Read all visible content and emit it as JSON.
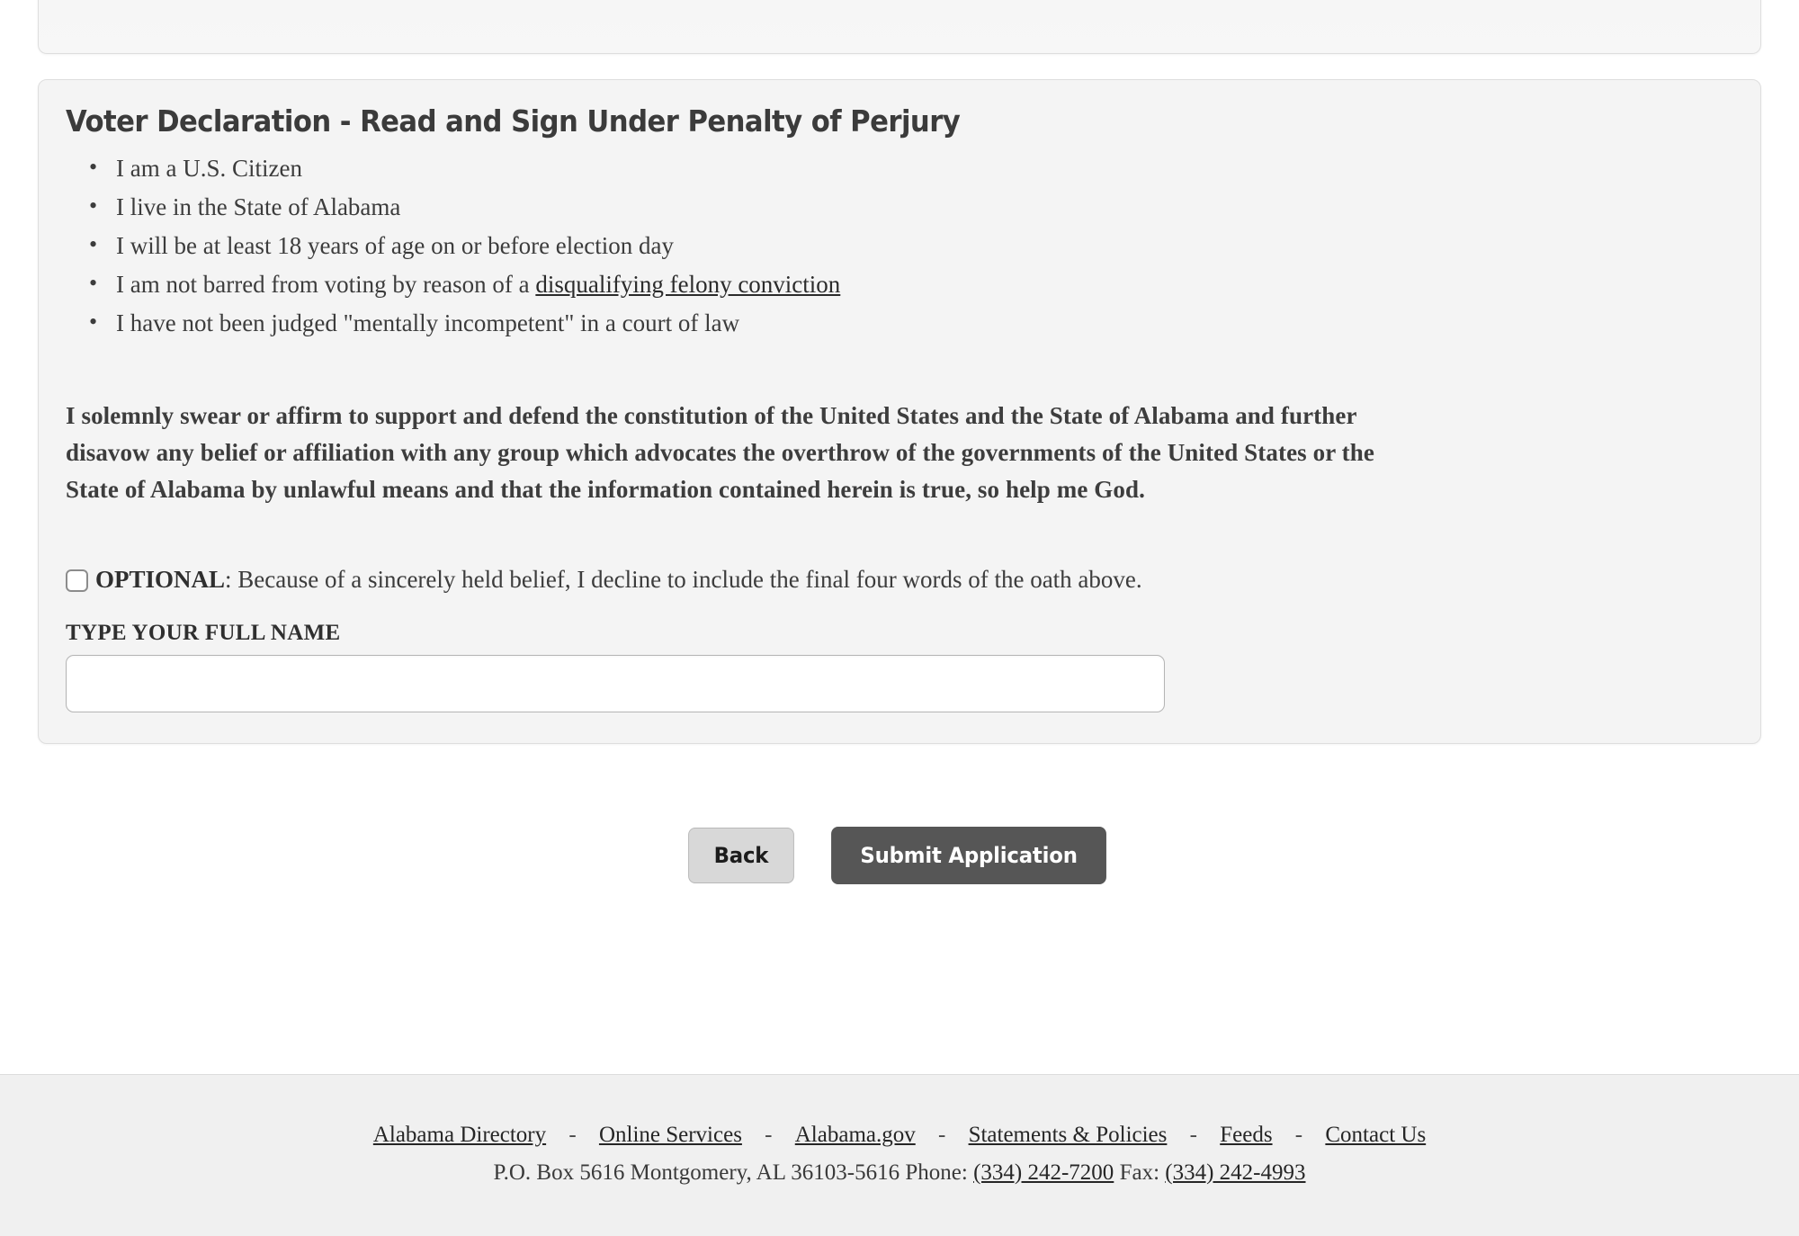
{
  "declaration": {
    "title": "Voter Declaration - Read and Sign Under Penalty of Perjury",
    "bullets": [
      {
        "text": "I am a U.S. Citizen"
      },
      {
        "text": "I live in the State of Alabama"
      },
      {
        "text": "I will be at least 18 years of age on or before election day"
      },
      {
        "text_before": "I am not barred from voting by reason of a ",
        "link": "disqualifying felony conviction"
      },
      {
        "text": "I have not been judged \"mentally incompetent\" in a court of law"
      }
    ],
    "oath": "I solemnly swear or affirm to support and defend the constitution of the United States and the State of Alabama and further disavow any belief or affiliation with any group which advocates the overthrow of the governments of the United States or the State of Alabama by unlawful means and that the information contained herein is true, so help me God.",
    "optional": {
      "checked": false,
      "prefix": "OPTIONAL",
      "text": ": Because of a sincerely held belief, I decline to include the final four words of the oath above."
    },
    "name_field": {
      "label": "TYPE YOUR FULL NAME",
      "value": "",
      "placeholder": ""
    }
  },
  "actions": {
    "back_label": "Back",
    "submit_label": "Submit Application"
  },
  "footer": {
    "links": [
      "Alabama Directory",
      "Online Services",
      "Alabama.gov",
      "Statements & Policies",
      "Feeds",
      "Contact Us"
    ],
    "separator": "-",
    "address_prefix": "P.O. Box 5616 Montgomery, AL 36103-5616 Phone: ",
    "phone": "(334) 242-7200",
    "fax_label": " Fax: ",
    "fax": "(334) 242-4993"
  },
  "colors": {
    "page_bg": "#ffffff",
    "card_bg": "#f3f3f3",
    "card_border": "#dedede",
    "submit_bg": "#565656",
    "back_bg": "#d8d8d8",
    "footer_bg": "#f0f0f0",
    "text": "#3c3c3c"
  }
}
